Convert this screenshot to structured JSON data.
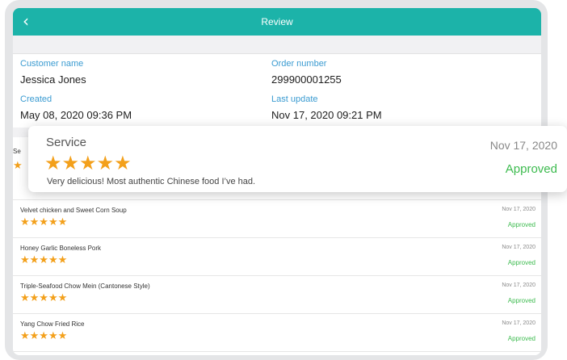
{
  "header": {
    "back_icon": "chevron-left-icon",
    "back_glyph": "‹",
    "title": "Review"
  },
  "info": {
    "customer_name_label": "Customer name",
    "customer_name": "Jessica Jones",
    "order_number_label": "Order number",
    "order_number": "299900001255",
    "created_label": "Created",
    "created": "May 08, 2020 09:36 PM",
    "last_update_label": "Last update",
    "last_update": "Nov 17, 2020 09:21 PM"
  },
  "peek": {
    "label": "Se",
    "star": "★"
  },
  "popup": {
    "name": "Service",
    "stars": "★★★★★",
    "comment": "Very delicious! Most authentic Chinese food I’ve had.",
    "date": "Nov 17, 2020",
    "status": "Approved"
  },
  "reviews": [
    {
      "name": "Velvet chicken and Sweet Corn Soup",
      "stars": "★★★★★",
      "date": "Nov 17, 2020",
      "status": "Approved"
    },
    {
      "name": "Honey Garlic Boneless Pork",
      "stars": "★★★★★",
      "date": "Nov 17, 2020",
      "status": "Approved"
    },
    {
      "name": "Triple-Seafood Chow Mein (Cantonese Style)",
      "stars": "★★★★★",
      "date": "Nov 17, 2020",
      "status": "Approved"
    },
    {
      "name": "Yang Chow Fried Rice",
      "stars": "★★★★★",
      "date": "Nov 17, 2020",
      "status": "Approved"
    }
  ],
  "colors": {
    "accent": "#1cb3a9",
    "label_blue": "#3a9bd1",
    "star": "#f3a01b",
    "approved": "#3dbb4f"
  }
}
